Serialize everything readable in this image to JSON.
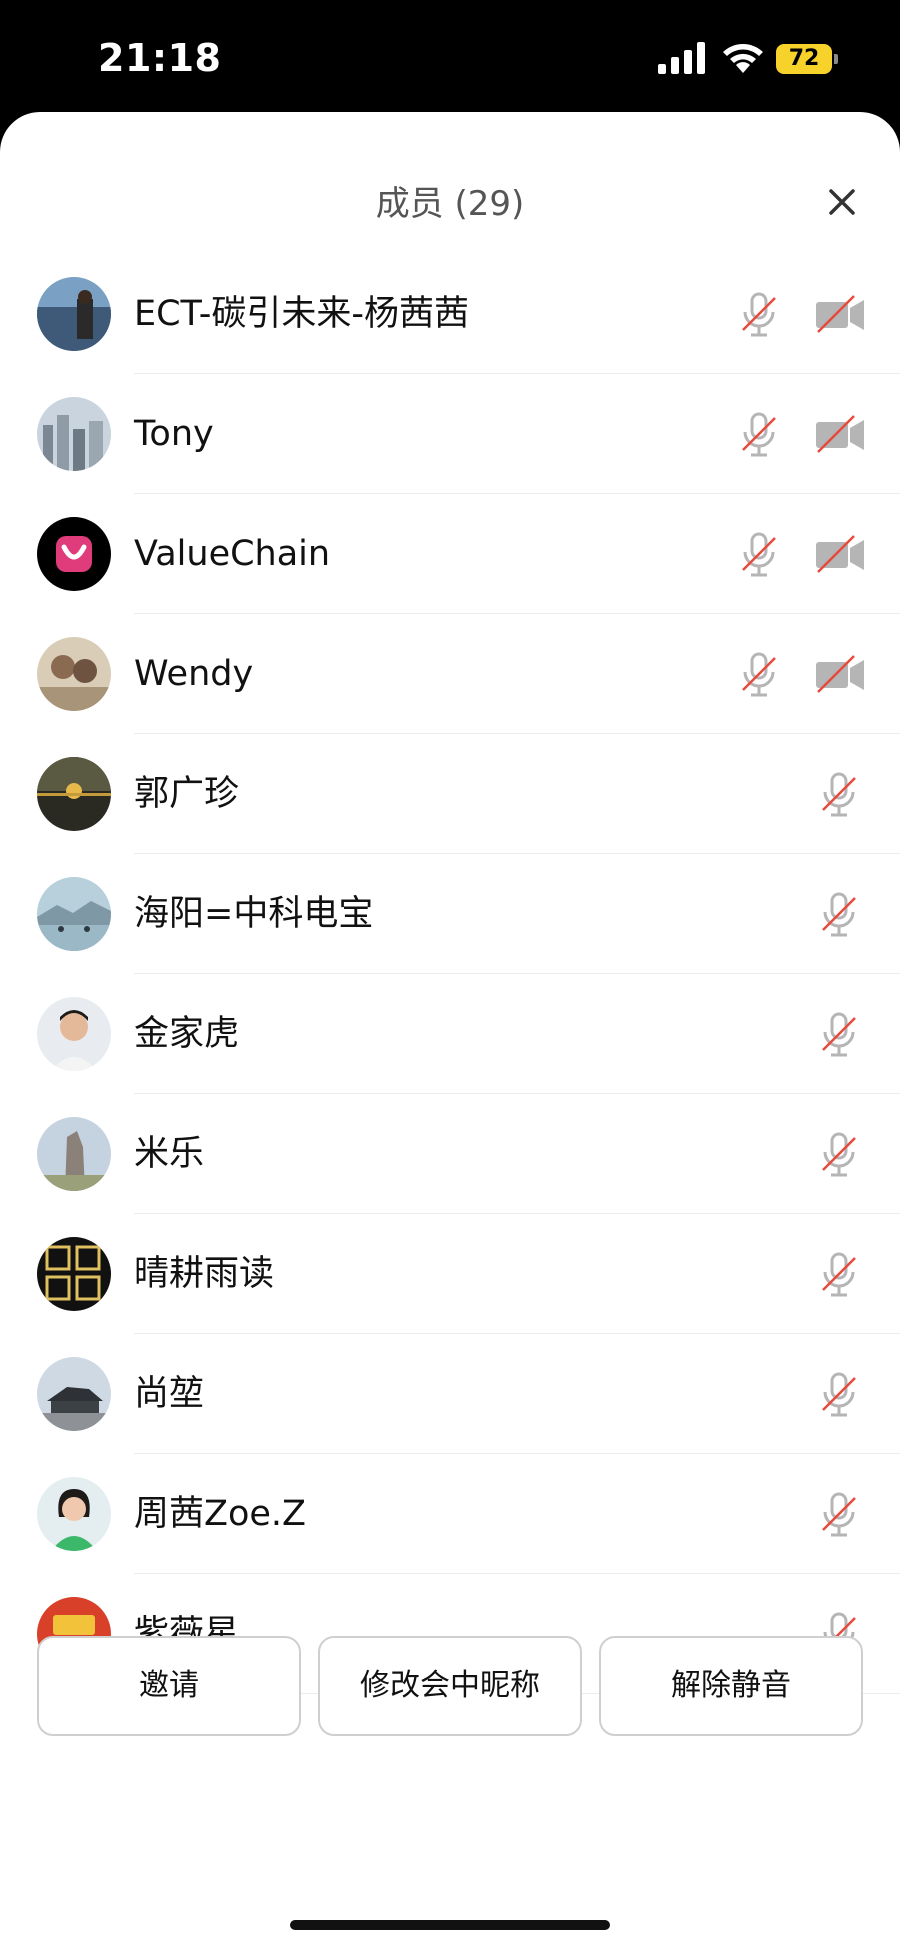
{
  "status": {
    "time": "21:18",
    "battery": "72",
    "icons": [
      "signal-icon",
      "wifi-icon",
      "battery-icon"
    ]
  },
  "header": {
    "title": "成员 (29)",
    "close_icon": "close-icon"
  },
  "members": [
    {
      "name": "ECT-碳引未来-杨茜茜",
      "mic": "muted",
      "camera": "off"
    },
    {
      "name": "Tony",
      "mic": "muted",
      "camera": "off"
    },
    {
      "name": "ValueChain",
      "mic": "muted",
      "camera": "off"
    },
    {
      "name": "Wendy",
      "mic": "muted",
      "camera": "off"
    },
    {
      "name": "郭广珍",
      "mic": "muted"
    },
    {
      "name": "海阳=中科电宝",
      "mic": "muted"
    },
    {
      "name": "金家虎",
      "mic": "muted"
    },
    {
      "name": "米乐",
      "mic": "muted"
    },
    {
      "name": "晴耕雨读",
      "mic": "muted"
    },
    {
      "name": "尚堃",
      "mic": "muted"
    },
    {
      "name": "周茜Zoe.Z",
      "mic": "muted"
    },
    {
      "name": "紫薇星",
      "mic": "muted"
    }
  ],
  "actions": {
    "invite": "邀请",
    "rename": "修改会中昵称",
    "unmute": "解除静音"
  },
  "colors": {
    "muted_slash": "#e64a3b",
    "icon_gray": "#b5b5b5"
  }
}
